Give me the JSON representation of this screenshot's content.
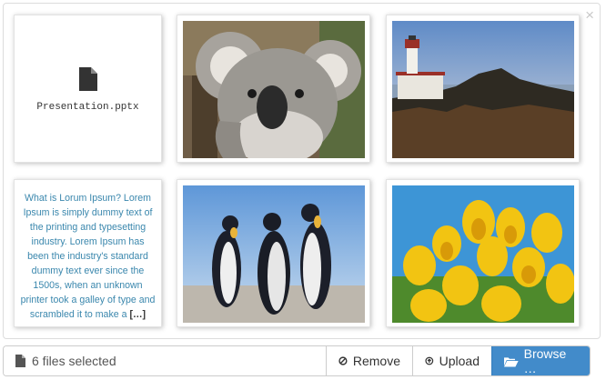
{
  "preview": {
    "close_glyph": "×",
    "file_caption": "Presentation.pptx",
    "text_snippet": "What is Lorum Ipsum? Lorem Ipsum is simply dummy text of the printing and typesetting industry. Lorem Ipsum has been the industry's standard dummy text ever since the 1500s, when an unknown printer took a galley of type and scrambled it to make a",
    "text_more": "[…]"
  },
  "footer": {
    "status": "6 files selected",
    "remove_label": "Remove",
    "upload_label": "Upload",
    "browse_label": "Browse …"
  },
  "colors": {
    "primary": "#428bca",
    "snippet_text": "#3a87ad"
  }
}
